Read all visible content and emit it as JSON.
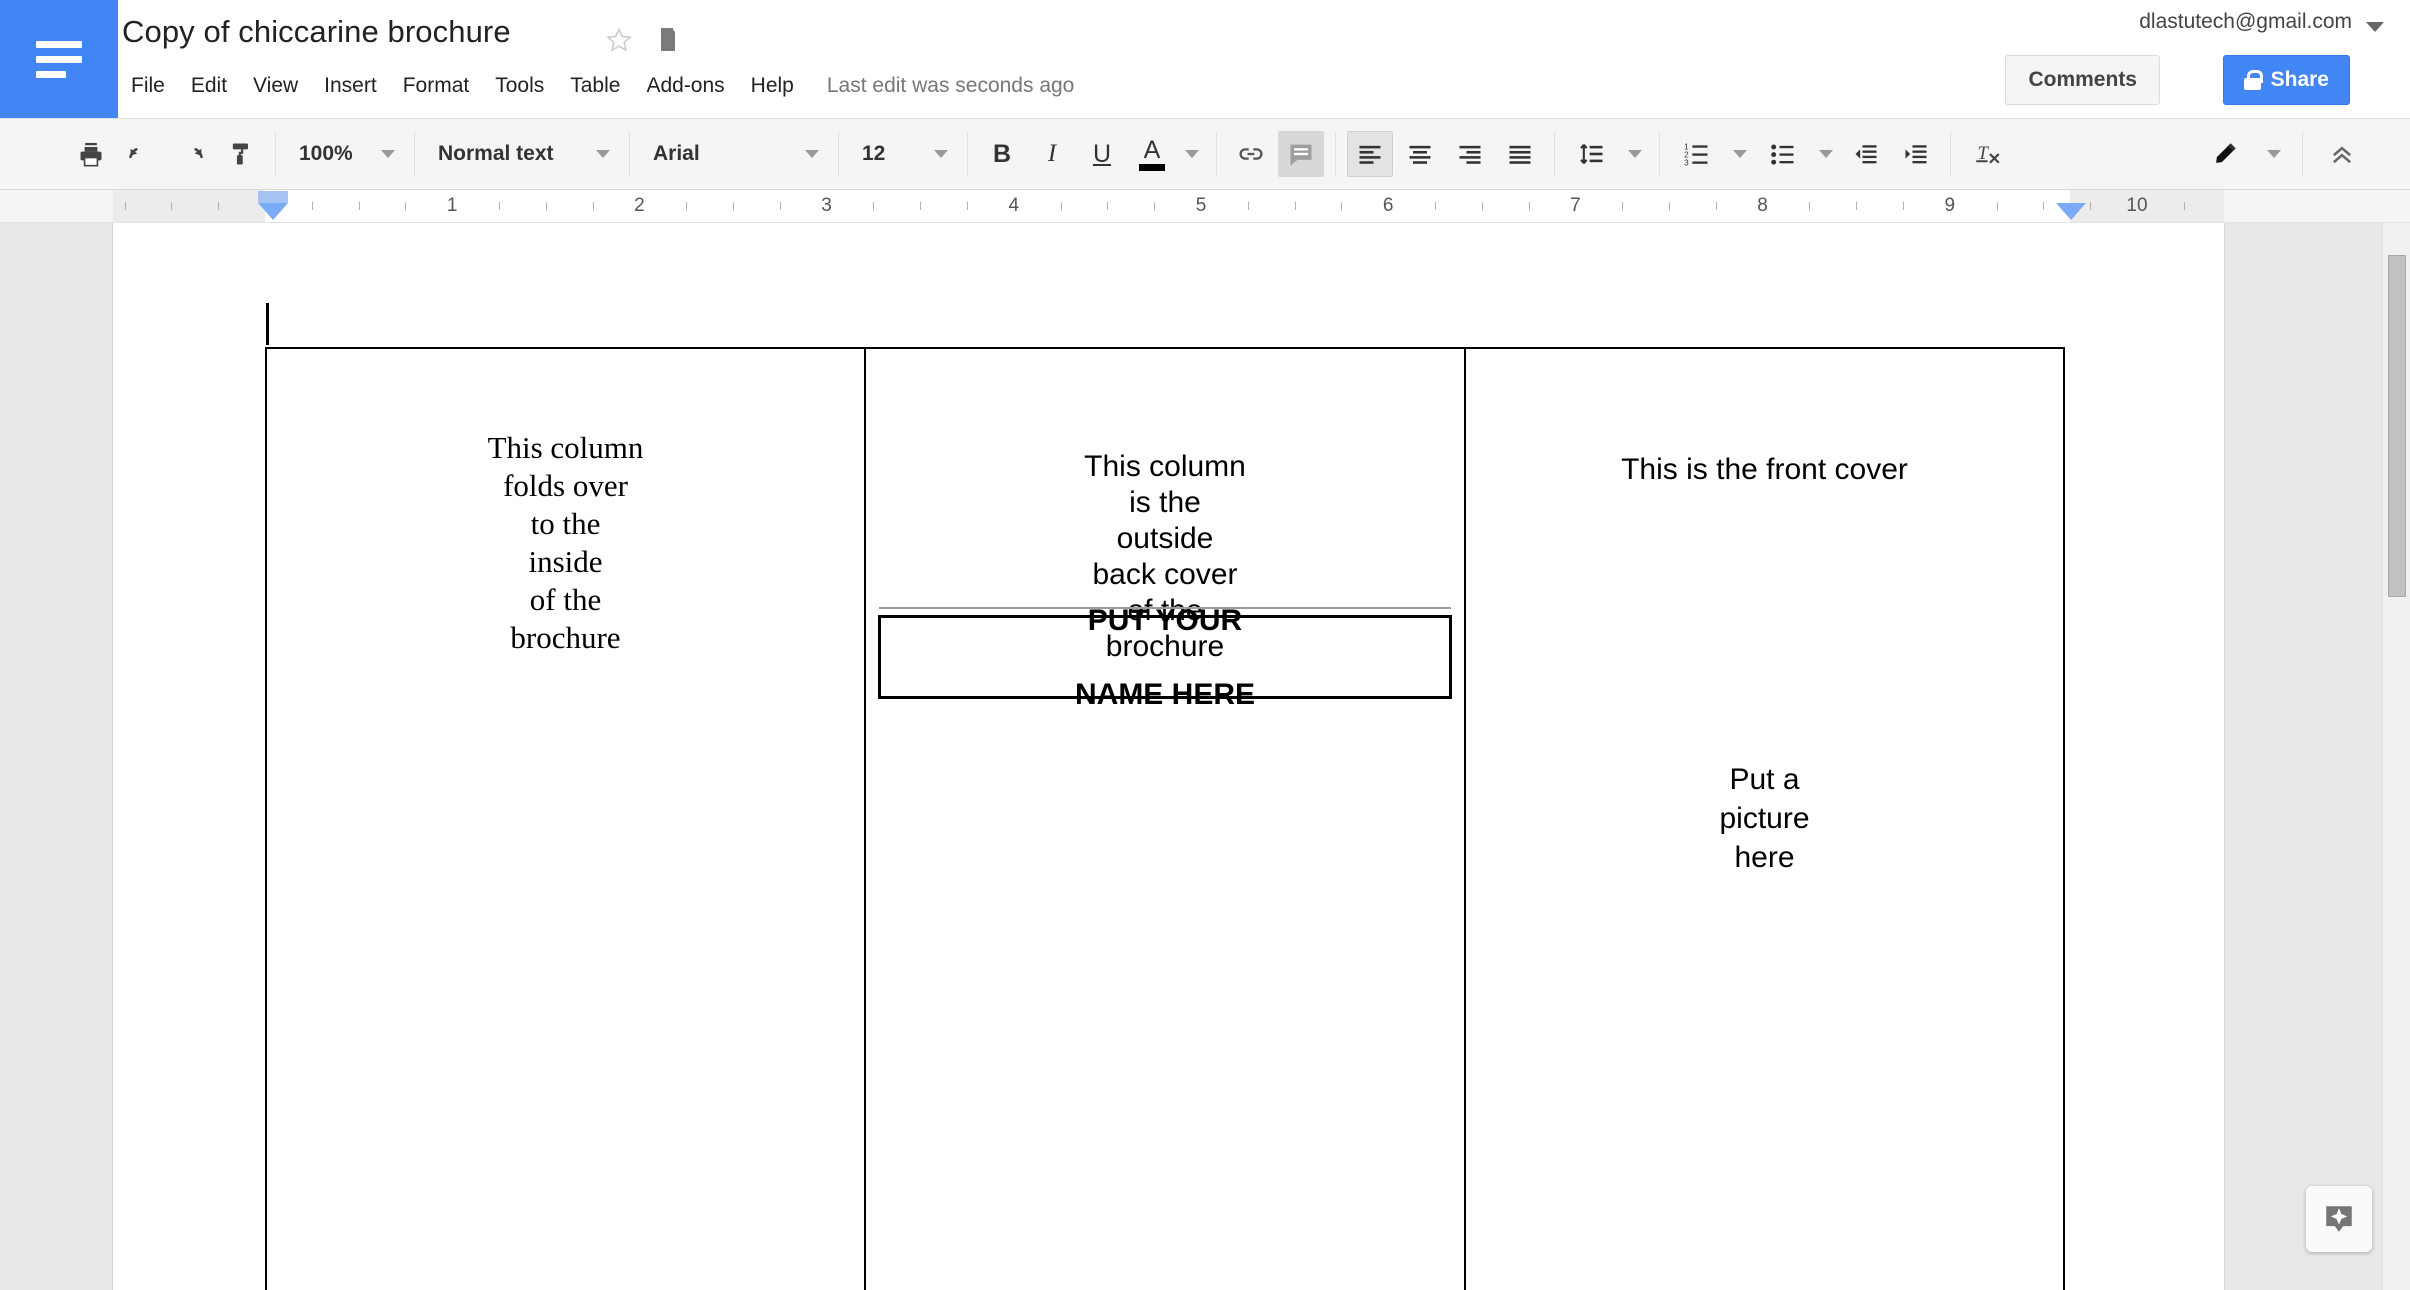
{
  "app": {
    "logo_icon": "docs-lines-icon",
    "doc_title": "Copy of chiccarine brochure",
    "star_icon": "star-outline-icon",
    "folder_icon": "folder-icon",
    "account_email": "dlastutech@gmail.com",
    "account_caret_icon": "chevron-down-icon"
  },
  "menubar": {
    "items": [
      {
        "label": "File"
      },
      {
        "label": "Edit"
      },
      {
        "label": "View"
      },
      {
        "label": "Insert"
      },
      {
        "label": "Format"
      },
      {
        "label": "Tools"
      },
      {
        "label": "Table"
      },
      {
        "label": "Add-ons"
      },
      {
        "label": "Help"
      }
    ],
    "last_edit": "Last edit was seconds ago"
  },
  "header_actions": {
    "comments_label": "Comments",
    "share_label": "Share",
    "share_lock_icon": "lock-icon",
    "share_color": "#4285f4"
  },
  "toolbar": {
    "print_icon": "print-icon",
    "undo_icon": "undo-arrow-icon",
    "redo_icon": "redo-arrow-icon",
    "paint_format_icon": "paint-roller-icon",
    "zoom_value": "100%",
    "style_value": "Normal text",
    "font_value": "Arial",
    "size_value": "12",
    "bold_label": "B",
    "italic_label": "I",
    "underline_label": "U",
    "text_color_label": "A",
    "text_color": "#000000",
    "link_icon": "link-icon",
    "comment_icon": "add-comment-icon",
    "align_left_icon": "align-left-icon",
    "align_center_icon": "align-center-icon",
    "align_right_icon": "align-right-icon",
    "align_justify_icon": "align-justify-icon",
    "line_spacing_icon": "line-spacing-icon",
    "numbered_list_icon": "numbered-list-icon",
    "bulleted_list_icon": "bulleted-list-icon",
    "decrease_indent_icon": "decrease-indent-icon",
    "increase_indent_icon": "increase-indent-icon",
    "clear_formatting_icon": "clear-formatting-icon",
    "edit_mode_icon": "pencil-icon",
    "collapse_toolbar_icon": "chevron-up-double-icon",
    "active_alignment": "align-left"
  },
  "ruler": {
    "numbers": [
      "1",
      "2",
      "3",
      "4",
      "5",
      "6",
      "7",
      "8",
      "9",
      "10"
    ],
    "left_indent_marker": "left-indent-marker",
    "right_indent_marker": "right-indent-marker"
  },
  "document": {
    "column1": {
      "lines": [
        "This column",
        "folds over",
        "to the",
        "inside",
        "of the",
        "brochure"
      ],
      "font": "serif"
    },
    "column2": {
      "lines": [
        "This column",
        "is the",
        "outside",
        "back cover",
        "of the",
        "brochure"
      ],
      "name_box_lines": [
        "PUT YOUR",
        "NAME HERE"
      ],
      "font": "sans-serif"
    },
    "column3": {
      "title": "This is the front cover",
      "picture_lines": [
        "Put a",
        "picture",
        "here"
      ],
      "font": "sans-serif"
    }
  },
  "explore": {
    "icon": "explore-sparkle-icon"
  },
  "scrollbar": {
    "vertical_thumb": "vertical-scroll-thumb"
  }
}
